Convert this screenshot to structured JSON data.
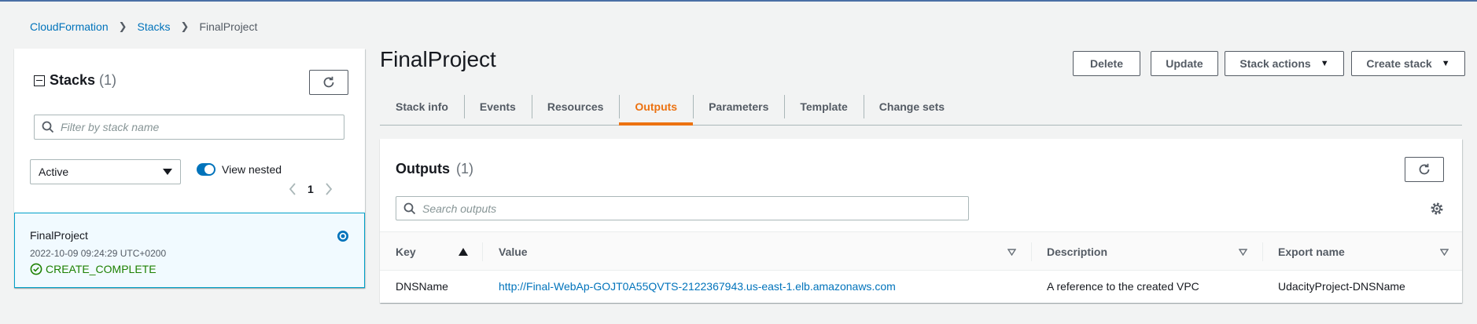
{
  "breadcrumb": {
    "root": "CloudFormation",
    "stacks": "Stacks",
    "current": "FinalProject"
  },
  "left_panel": {
    "title": "Stacks",
    "count": "(1)",
    "filter_placeholder": "Filter by stack name",
    "status_filter": "Active",
    "view_nested_label": "View nested",
    "view_nested_on": true,
    "page_number": "1",
    "stacks": [
      {
        "name": "FinalProject",
        "timestamp": "2022-10-09 09:24:29 UTC+0200",
        "status": "CREATE_COMPLETE",
        "status_color": "#1d8102"
      }
    ]
  },
  "main": {
    "title": "FinalProject",
    "buttons": {
      "delete": "Delete",
      "update": "Update",
      "stack_actions": "Stack actions",
      "create_stack": "Create stack"
    },
    "tabs": [
      "Stack info",
      "Events",
      "Resources",
      "Outputs",
      "Parameters",
      "Template",
      "Change sets"
    ],
    "active_tab": "Outputs"
  },
  "outputs": {
    "title": "Outputs",
    "count": "(1)",
    "search_placeholder": "Search outputs",
    "columns": {
      "key": "Key",
      "value": "Value",
      "description": "Description",
      "export_name": "Export name"
    },
    "rows": [
      {
        "key": "DNSName",
        "value": "http://Final-WebAp-GOJT0A55QVTS-2122367943.us-east-1.elb.amazonaws.com",
        "description": "A reference to the created VPC",
        "export_name": "UdacityProject-DNSName"
      }
    ]
  },
  "colors": {
    "link": "#0073bb",
    "accent": "#ec7211",
    "selected_border": "#00a1c9",
    "success": "#1d8102"
  }
}
